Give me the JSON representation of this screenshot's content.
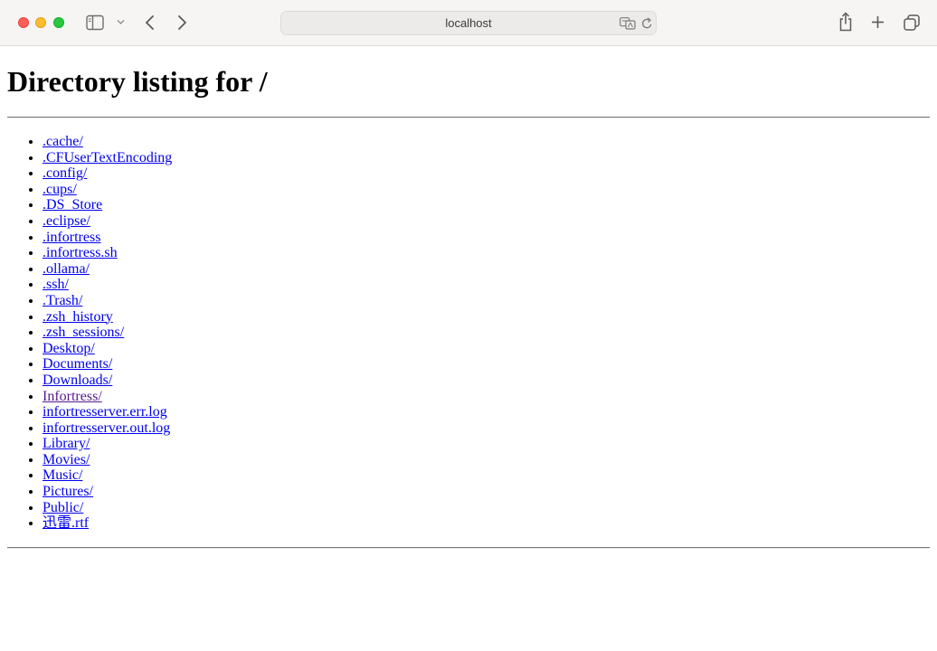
{
  "browser": {
    "address": "localhost",
    "icons": {
      "sidebar": "sidebar-icon",
      "chevron": "chevron-down-icon",
      "back": "back-arrow-icon",
      "forward": "forward-arrow-icon",
      "translate": "translate-icon",
      "reload": "reload-icon",
      "share": "share-icon",
      "new_tab": "plus-icon",
      "tabs": "tab-overview-icon"
    }
  },
  "page": {
    "heading": "Directory listing for /",
    "entries": [
      {
        "label": ".cache/",
        "visited": false
      },
      {
        "label": ".CFUserTextEncoding",
        "visited": false
      },
      {
        "label": ".config/",
        "visited": false
      },
      {
        "label": ".cups/",
        "visited": false
      },
      {
        "label": ".DS_Store",
        "visited": false
      },
      {
        "label": ".eclipse/",
        "visited": false
      },
      {
        "label": ".infortress",
        "visited": false
      },
      {
        "label": ".infortress.sh",
        "visited": false
      },
      {
        "label": ".ollama/",
        "visited": false
      },
      {
        "label": ".ssh/",
        "visited": false
      },
      {
        "label": ".Trash/",
        "visited": false
      },
      {
        "label": ".zsh_history",
        "visited": false
      },
      {
        "label": ".zsh_sessions/",
        "visited": false
      },
      {
        "label": "Desktop/",
        "visited": false
      },
      {
        "label": "Documents/",
        "visited": false
      },
      {
        "label": "Downloads/",
        "visited": false
      },
      {
        "label": "Infortress/",
        "visited": true
      },
      {
        "label": "infortresserver.err.log",
        "visited": false
      },
      {
        "label": "infortresserver.out.log",
        "visited": false
      },
      {
        "label": "Library/",
        "visited": false
      },
      {
        "label": "Movies/",
        "visited": false
      },
      {
        "label": "Music/",
        "visited": false
      },
      {
        "label": "Pictures/",
        "visited": false
      },
      {
        "label": "Public/",
        "visited": false
      },
      {
        "label": "迅雷.rtf",
        "visited": false
      }
    ]
  },
  "colors": {
    "link": "#0000ee",
    "visited_link": "#551a8b",
    "close": "#ff5f57",
    "minimize": "#febc2e",
    "maximize": "#28c840"
  }
}
